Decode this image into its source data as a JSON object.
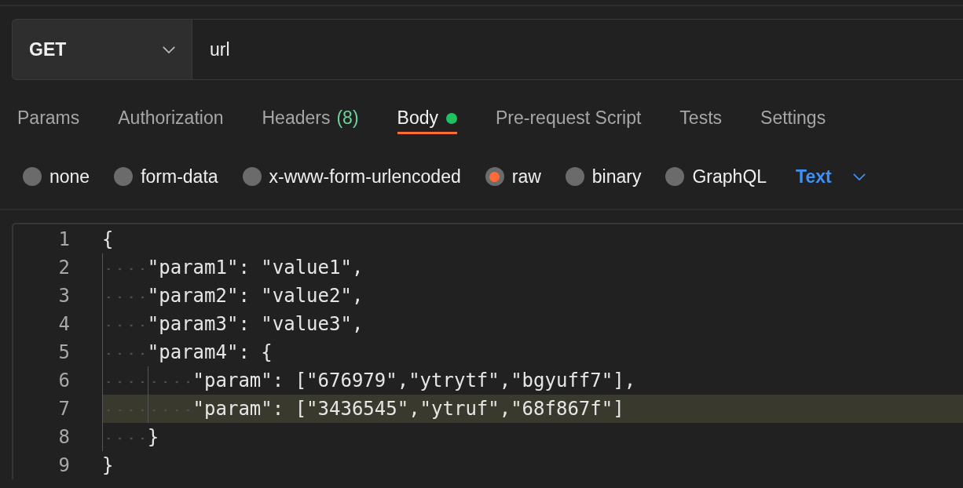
{
  "method": {
    "label": "GET"
  },
  "url": {
    "value": "url"
  },
  "tabs": [
    {
      "label": "Params",
      "selected": false,
      "has_body": false
    },
    {
      "label": "Authorization",
      "selected": false,
      "has_body": false
    },
    {
      "label": "Headers",
      "count": "(8)",
      "selected": false,
      "has_body": false
    },
    {
      "label": "Body",
      "selected": true,
      "has_body": true
    },
    {
      "label": "Pre-request Script",
      "selected": false,
      "has_body": false
    },
    {
      "label": "Tests",
      "selected": false,
      "has_body": false
    },
    {
      "label": "Settings",
      "selected": false,
      "has_body": false
    }
  ],
  "body_types": [
    {
      "label": "none",
      "selected": false
    },
    {
      "label": "form-data",
      "selected": false
    },
    {
      "label": "x-www-form-urlencoded",
      "selected": false
    },
    {
      "label": "raw",
      "selected": true
    },
    {
      "label": "binary",
      "selected": false
    },
    {
      "label": "GraphQL",
      "selected": false
    }
  ],
  "format": {
    "label": "Text"
  },
  "editor": {
    "lines": [
      {
        "number": "1",
        "text": "{",
        "current": false
      },
      {
        "number": "2",
        "text": "    \"param1\": \"value1\",",
        "current": false
      },
      {
        "number": "3",
        "text": "    \"param2\": \"value2\",",
        "current": false
      },
      {
        "number": "4",
        "text": "    \"param3\": \"value3\",",
        "current": false
      },
      {
        "number": "5",
        "text": "    \"param4\": {",
        "current": false
      },
      {
        "number": "6",
        "text": "        \"param\": [\"676979\",\"ytrytf\",\"bgyuff7\"],",
        "current": false
      },
      {
        "number": "7",
        "text": "        \"param\": [\"3436545\",\"ytruf\",\"68f867f\"]",
        "current": true
      },
      {
        "number": "8",
        "text": "    }",
        "current": false
      },
      {
        "number": "9",
        "text": "}",
        "current": false
      }
    ]
  }
}
